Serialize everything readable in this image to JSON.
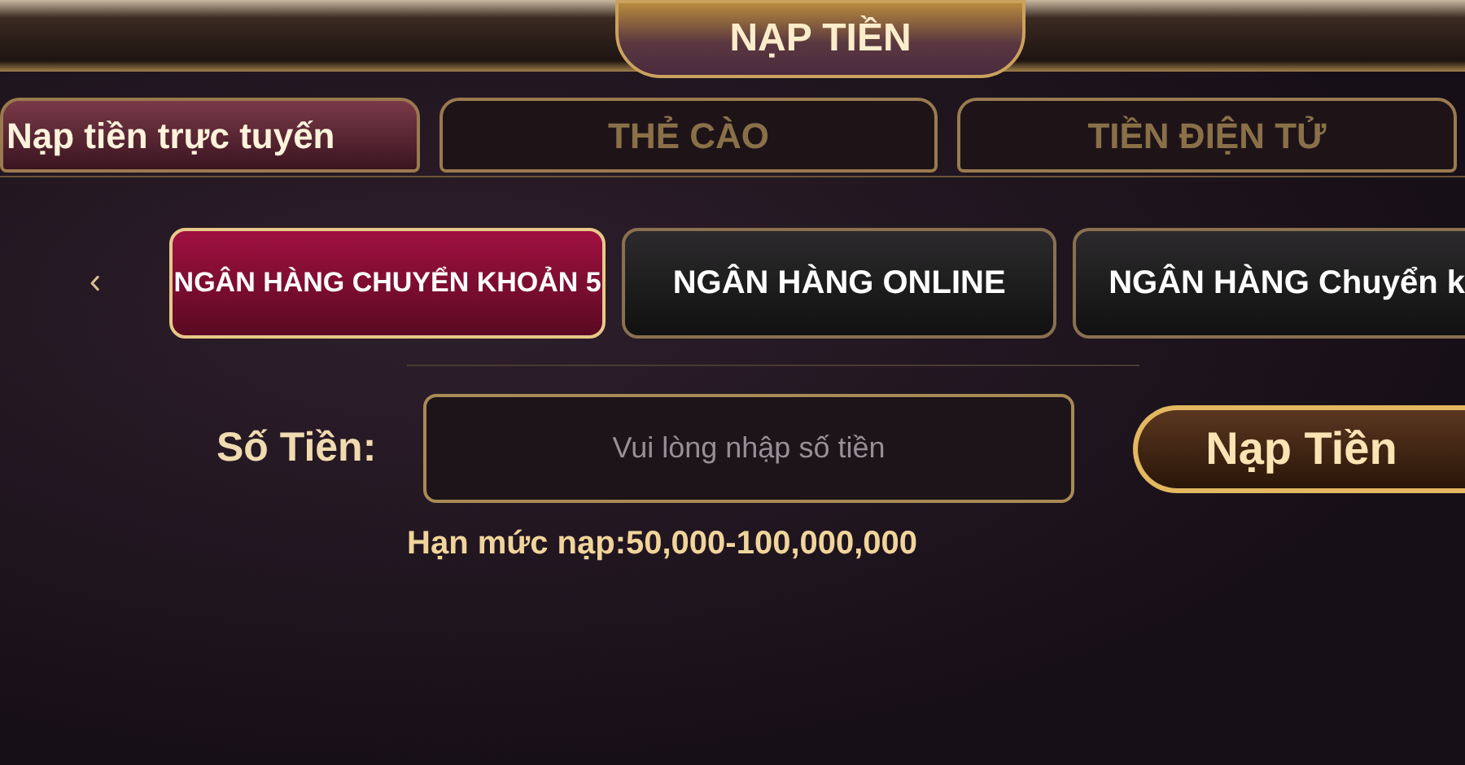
{
  "header": {
    "title": "NẠP TIỀN"
  },
  "tabs": [
    {
      "label": "Nạp tiền trực tuyến",
      "selected": true
    },
    {
      "label": "THẺ CÀO",
      "selected": false
    },
    {
      "label": "TIỀN ĐIỆN TỬ",
      "selected": false
    }
  ],
  "banks": [
    {
      "label": "NGÂN HÀNG CHUYỂN KHOẢN 5",
      "selected": true
    },
    {
      "label": "NGÂN HÀNG ONLINE",
      "selected": false
    },
    {
      "label": "NGÂN HÀNG Chuyển k",
      "selected": false
    }
  ],
  "amount": {
    "label": "Số Tiền:",
    "placeholder": "Vui lòng nhập số tiền",
    "button": "Nạp Tiền",
    "limit": "Hạn mức nạp:50,000-100,000,000"
  }
}
